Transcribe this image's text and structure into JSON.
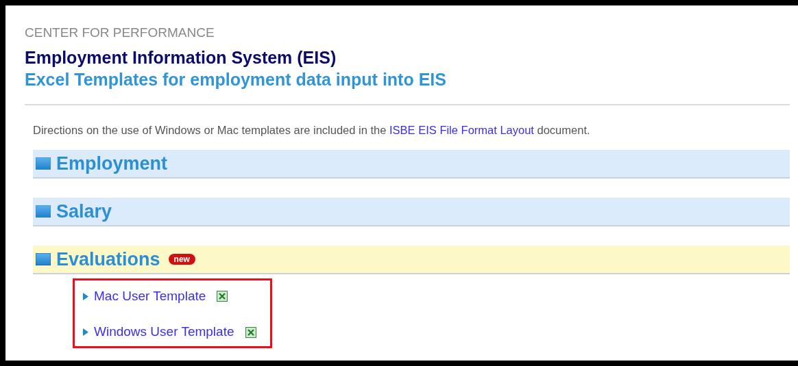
{
  "header": {
    "kicker": "CENTER FOR PERFORMANCE",
    "title": "Employment Information System (EIS)",
    "subtitle": "Excel Templates for employment data input into EIS"
  },
  "intro": {
    "before": "Directions on the use of Windows or Mac templates are included in the ",
    "link": "ISBE EIS File Format Layout",
    "after": " document."
  },
  "sections": [
    {
      "title": "Employment",
      "color": "#dcebfb",
      "expanded": false
    },
    {
      "title": "Salary",
      "color": "#dcebfb",
      "expanded": false
    },
    {
      "title": "Evaluations",
      "color": "#fdf8c8",
      "expanded": true,
      "badge": "new",
      "boxed": true,
      "children": [
        {
          "label": "Mac User Template"
        },
        {
          "label": "Windows User Template"
        }
      ]
    }
  ]
}
